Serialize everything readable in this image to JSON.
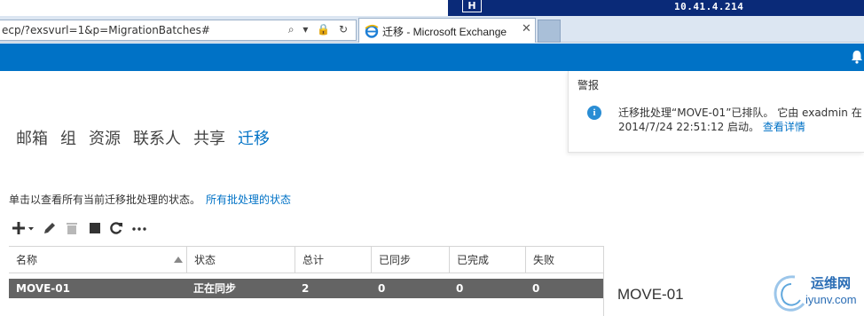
{
  "remote_session": {
    "pin_label": "H",
    "host_ip": "10.41.4.214"
  },
  "browser": {
    "address": "ecp/?exsvurl=1&p=MigrationBatches#",
    "address_tools": "⌕ ▾ 🔒 ↻",
    "tab_title": "迁移 - Microsoft Exchange",
    "tab_close": "✕"
  },
  "nav": {
    "items": [
      "邮箱",
      "组",
      "资源",
      "联系人",
      "共享",
      "迁移"
    ],
    "active": "迁移"
  },
  "notification": {
    "title": "警报",
    "icon": "i",
    "message": "迁移批处理“MOVE-01”已排队。 它由 exadmin 在 2014/7/24 22:51:12 启动。",
    "link": "查看详情"
  },
  "description": {
    "text": "单击以查看所有当前迁移批处理的状态。",
    "link": "所有批处理的状态"
  },
  "toolbar": {
    "icons": [
      "add-icon",
      "edit-icon",
      "delete-icon",
      "stop-icon",
      "refresh-icon",
      "more-icon"
    ]
  },
  "table": {
    "columns": [
      "名称",
      "状态",
      "总计",
      "已同步",
      "已完成",
      "失败"
    ],
    "rows": [
      {
        "name": "MOVE-01",
        "status": "正在同步",
        "total": "2",
        "synced": "0",
        "finalized": "0",
        "failed": "0"
      }
    ],
    "selected_row_color": "#646464"
  },
  "detail": {
    "title": "MOVE-01"
  },
  "watermark": {
    "line1": "运维网",
    "line2": "iyunv.com"
  },
  "colors": {
    "accent": "#0072c6",
    "rdp_bar": "#0a2a78",
    "chrome": "#dce6f2"
  }
}
